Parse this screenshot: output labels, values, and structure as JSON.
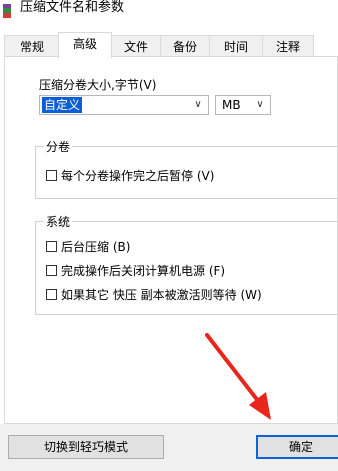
{
  "window": {
    "title": "压缩文件名和参数"
  },
  "tabs": [
    {
      "label": "常规",
      "active": false
    },
    {
      "label": "高级",
      "active": true
    },
    {
      "label": "文件",
      "active": false
    },
    {
      "label": "备份",
      "active": false
    },
    {
      "label": "时间",
      "active": false
    },
    {
      "label": "注释",
      "active": false
    }
  ],
  "volume_size": {
    "label": "压缩分卷大小,字节(V)",
    "value": "自定义",
    "unit": "MB"
  },
  "group_volume": {
    "title": "分卷",
    "options": [
      {
        "label": "每个分卷操作完之后暂停 (V)",
        "checked": false
      }
    ]
  },
  "group_system": {
    "title": "系统",
    "options": [
      {
        "label": "后台压缩 (B)",
        "checked": false
      },
      {
        "label": "完成操作后关闭计算机电源 (F)",
        "checked": false
      },
      {
        "label": "如果其它 快压 副本被激活则等待 (W)",
        "checked": false
      }
    ]
  },
  "buttons": {
    "switch_mode": "切换到轻巧模式",
    "ok": "确定"
  },
  "colors": {
    "accent": "#0a5fd6",
    "arrow": "#e8261c"
  }
}
